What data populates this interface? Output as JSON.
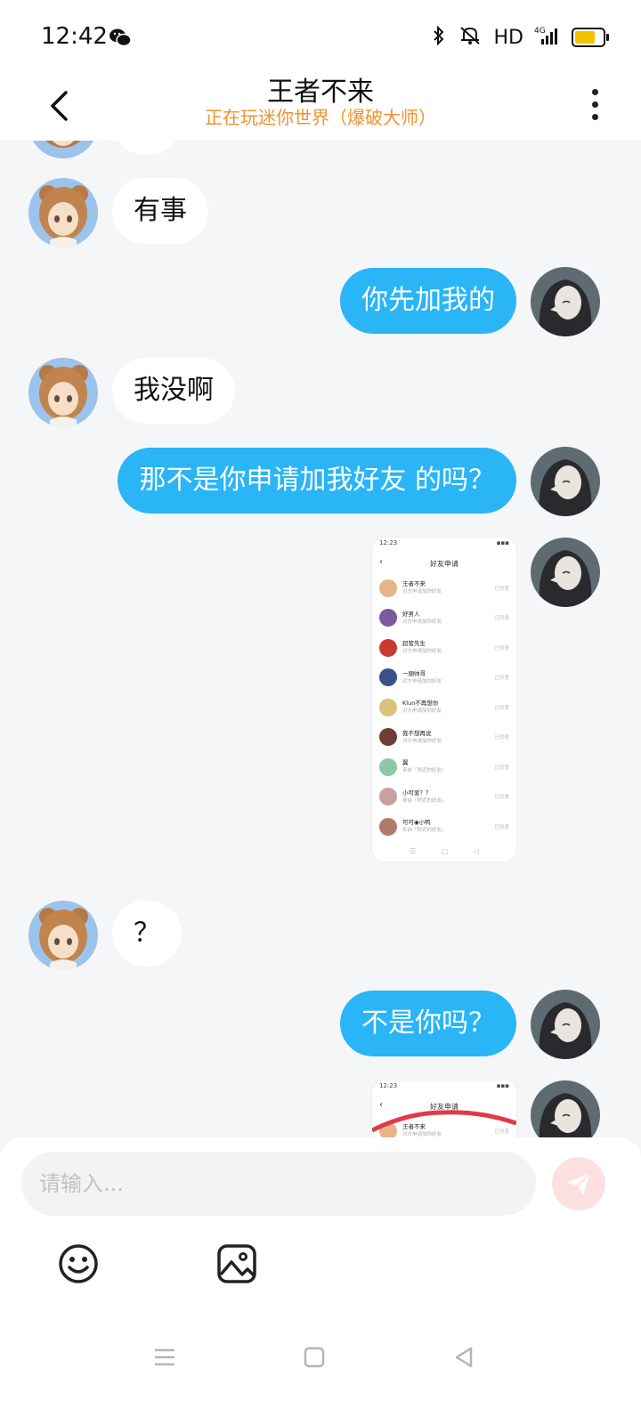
{
  "status_bar": {
    "time": "12:42",
    "network": "HD"
  },
  "header": {
    "title": "王者不来",
    "subtitle": "正在玩迷你世界（爆破大师）"
  },
  "messages": [
    {
      "from": "them",
      "text": "有事"
    },
    {
      "from": "me",
      "text": "你先加我的"
    },
    {
      "from": "them",
      "text": "我没啊"
    },
    {
      "from": "me",
      "text": "那不是你申请加我好友 的吗？"
    },
    {
      "from": "me",
      "type": "image"
    },
    {
      "from": "them",
      "text": "？"
    },
    {
      "from": "me",
      "text": "不是你吗？"
    },
    {
      "from": "me",
      "type": "image"
    }
  ],
  "shared_screenshot": {
    "time": "12:23",
    "title": "好友申请",
    "rows": [
      {
        "name": "王者不来",
        "sub": "对方申请加你好友",
        "status": "已同意"
      },
      {
        "name": "好男人",
        "sub": "对方申请加你好友",
        "status": "已同意"
      },
      {
        "name": "超管先生",
        "sub": "对方申请加你好友",
        "status": "已同意"
      },
      {
        "name": "一頭帅哥",
        "sub": "对方申请加你好友",
        "status": "已同意"
      },
      {
        "name": "Klun不再想你",
        "sub": "对方申请加你好友",
        "status": "已同意"
      },
      {
        "name": "我不想再说",
        "sub": "对方申请加你好友",
        "status": "已同意"
      },
      {
        "name": "翼",
        "sub": "来自「附近的好友」",
        "status": "已同意"
      },
      {
        "name": "小可爱？？",
        "sub": "来自「附近的好友」",
        "status": "已同意"
      },
      {
        "name": "可可◉小鸭",
        "sub": "来自「附近的好友」",
        "status": "已同意"
      }
    ]
  },
  "composer": {
    "placeholder": "请输入..."
  },
  "colors": {
    "accent": "#29b5f6",
    "subtitle": "#f0922e",
    "background": "#f4f6f8",
    "send_disabled": "#fde1e0"
  }
}
